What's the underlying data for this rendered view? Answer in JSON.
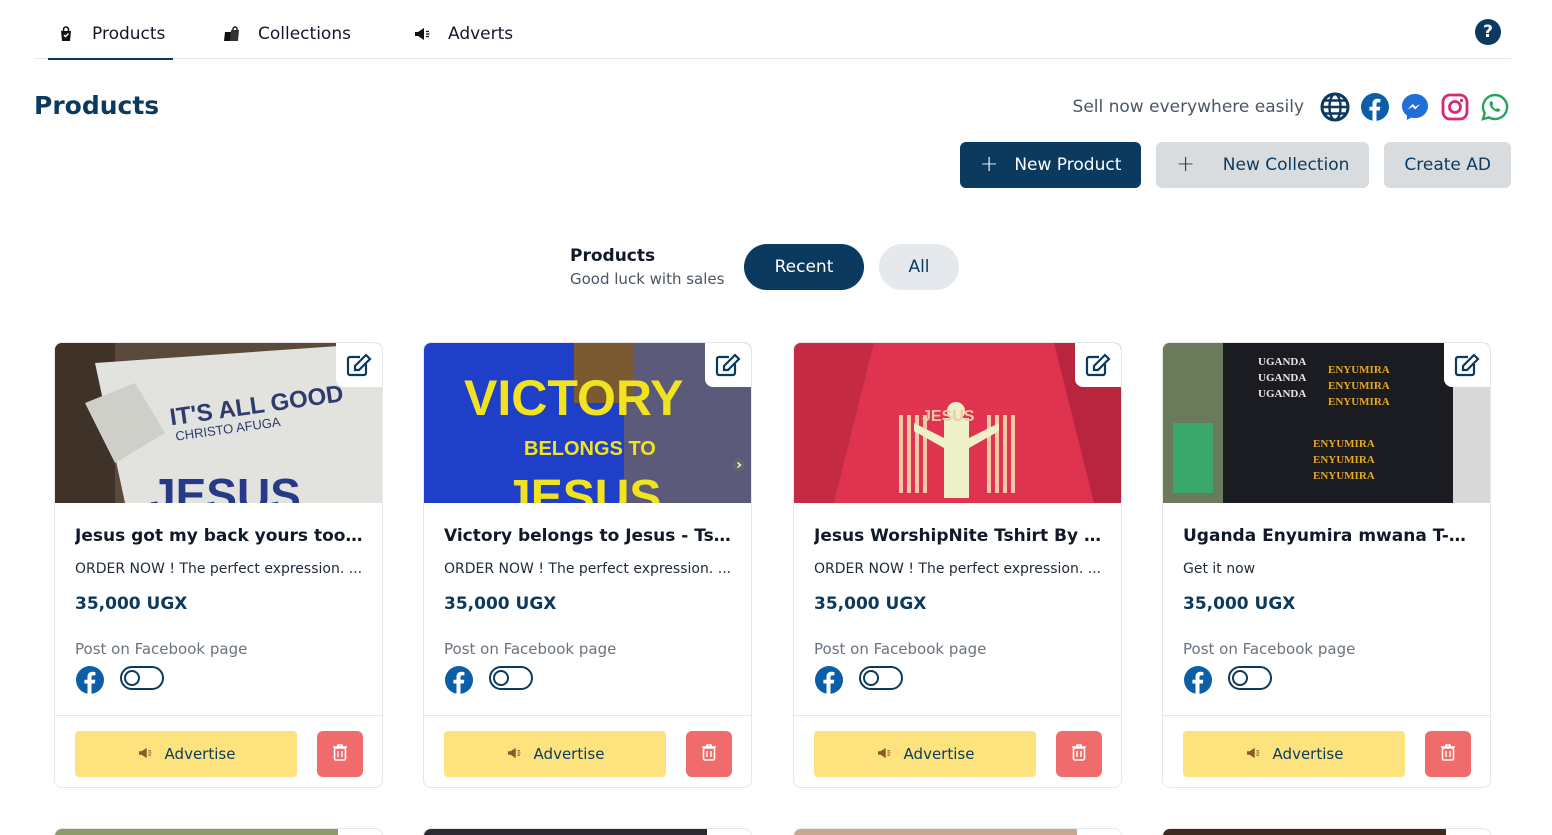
{
  "nav": {
    "tabs": [
      {
        "label": "Products",
        "icon": "shopping-bag-icon"
      },
      {
        "label": "Collections",
        "icon": "bags-icon"
      },
      {
        "label": "Adverts",
        "icon": "megaphone-icon"
      }
    ],
    "help_glyph": "?"
  },
  "header": {
    "title": "Products",
    "sell_text": "Sell now everywhere easily",
    "channels": [
      "globe-icon",
      "facebook-icon",
      "messenger-icon",
      "instagram-icon",
      "whatsapp-icon"
    ]
  },
  "actions": {
    "new_product": "New Product",
    "new_collection": "New Collection",
    "create_ad": "Create AD",
    "plus": "+"
  },
  "filter": {
    "title": "Products",
    "subtitle": "Good luck with sales",
    "recent": "Recent",
    "all": "All"
  },
  "products": [
    {
      "title": "Jesus got my back yours too - ...",
      "description": "ORDER NOW ! The perfect expression. ...",
      "price": "35,000 UGX",
      "post_label": "Post on Facebook page",
      "advertise": "Advertise",
      "image_text": [
        "IT'S ALL GOOD",
        "CHRISTO AFUGA",
        "JESUS"
      ]
    },
    {
      "title": "Victory belongs to Jesus - Tshi...",
      "description": "ORDER NOW ! The perfect expression. ...",
      "price": "35,000 UGX",
      "post_label": "Post on Facebook page",
      "advertise": "Advertise",
      "image_text": [
        "VICTORY",
        "BELONGS TO",
        "JESUS"
      ]
    },
    {
      "title": "Jesus WorshipNite Tshirt By Bo...",
      "description": "ORDER NOW ! The perfect expression. ...",
      "price": "35,000 UGX",
      "post_label": "Post on Facebook page",
      "advertise": "Advertise",
      "image_text": [
        "JESUS"
      ]
    },
    {
      "title": "Uganda Enyumira mwana T-s...",
      "description": "Get it now",
      "price": "35,000 UGX",
      "post_label": "Post on Facebook page",
      "advertise": "Advertise",
      "image_text": [
        "UGANDA",
        "ENYUMIRA"
      ]
    }
  ],
  "colors": {
    "primary": "#0b3a5e",
    "advertise_bg": "#fce37e",
    "delete_bg": "#f06b6b",
    "facebook": "#1877f2",
    "instagram": "#d62976",
    "whatsapp": "#25d366"
  }
}
